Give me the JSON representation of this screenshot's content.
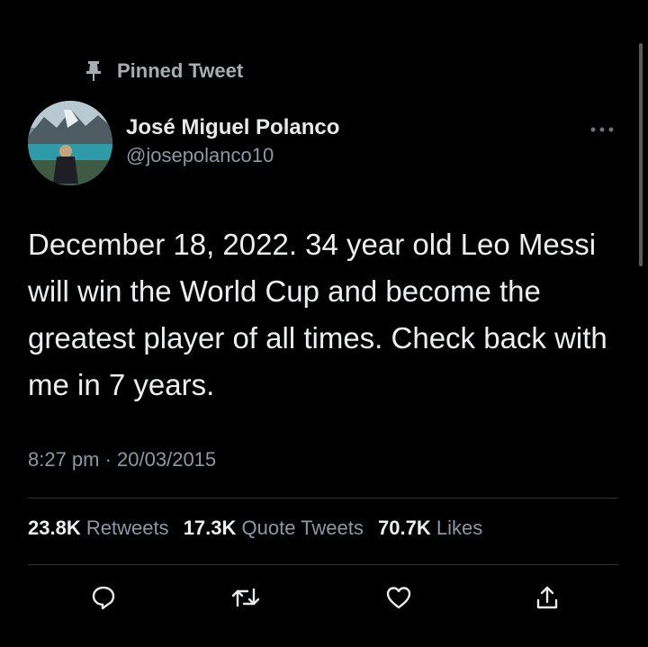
{
  "pinned": {
    "label": "Pinned Tweet",
    "icon": "pin-icon"
  },
  "author": {
    "name": "José Miguel Polanco",
    "handle": "@josepolanco10",
    "avatar_icon": "avatar"
  },
  "more_icon": "more-icon",
  "tweet": {
    "text": "December 18, 2022. 34 year old Leo Messi will win the World Cup and become the greatest player of all times. Check back with me in 7 years.",
    "timestamp": "8:27 pm · 20/03/2015"
  },
  "stats": {
    "retweets_count": "23.8K",
    "retweets_label": "Retweets",
    "quotes_count": "17.3K",
    "quotes_label": "Quote Tweets",
    "likes_count": "70.7K",
    "likes_label": "Likes"
  },
  "actions": {
    "reply_icon": "reply-icon",
    "retweet_icon": "retweet-icon",
    "like_icon": "heart-icon",
    "share_icon": "share-icon"
  },
  "colors": {
    "background": "#000000",
    "text_primary": "#e7e9ea",
    "text_secondary": "#8b98a5",
    "divider": "#2f3336"
  }
}
